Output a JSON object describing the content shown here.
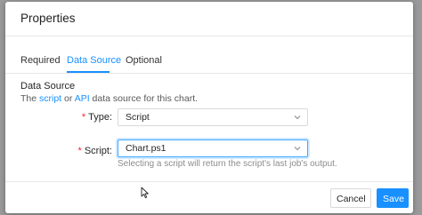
{
  "dialog": {
    "title": "Properties"
  },
  "tabs": [
    {
      "label": "Required"
    },
    {
      "label": "Data Source"
    },
    {
      "label": "Optional"
    }
  ],
  "active_tab": "Data Source",
  "section": {
    "title": "Data Source",
    "desc_prefix": "The ",
    "desc_link_script": "script",
    "desc_mid": " or ",
    "desc_link_api": "API",
    "desc_suffix": " data source for this chart."
  },
  "form": {
    "type": {
      "required_mark": "*",
      "label": "Type:",
      "value": "Script"
    },
    "script": {
      "required_mark": "*",
      "label": "Script:",
      "value": "Chart.ps1",
      "help": "Selecting a script will return the script's last job's output."
    }
  },
  "footer": {
    "cancel_label": "Cancel",
    "save_label": "Save"
  },
  "colors": {
    "accent": "#1890ff",
    "required": "#f5222d"
  }
}
